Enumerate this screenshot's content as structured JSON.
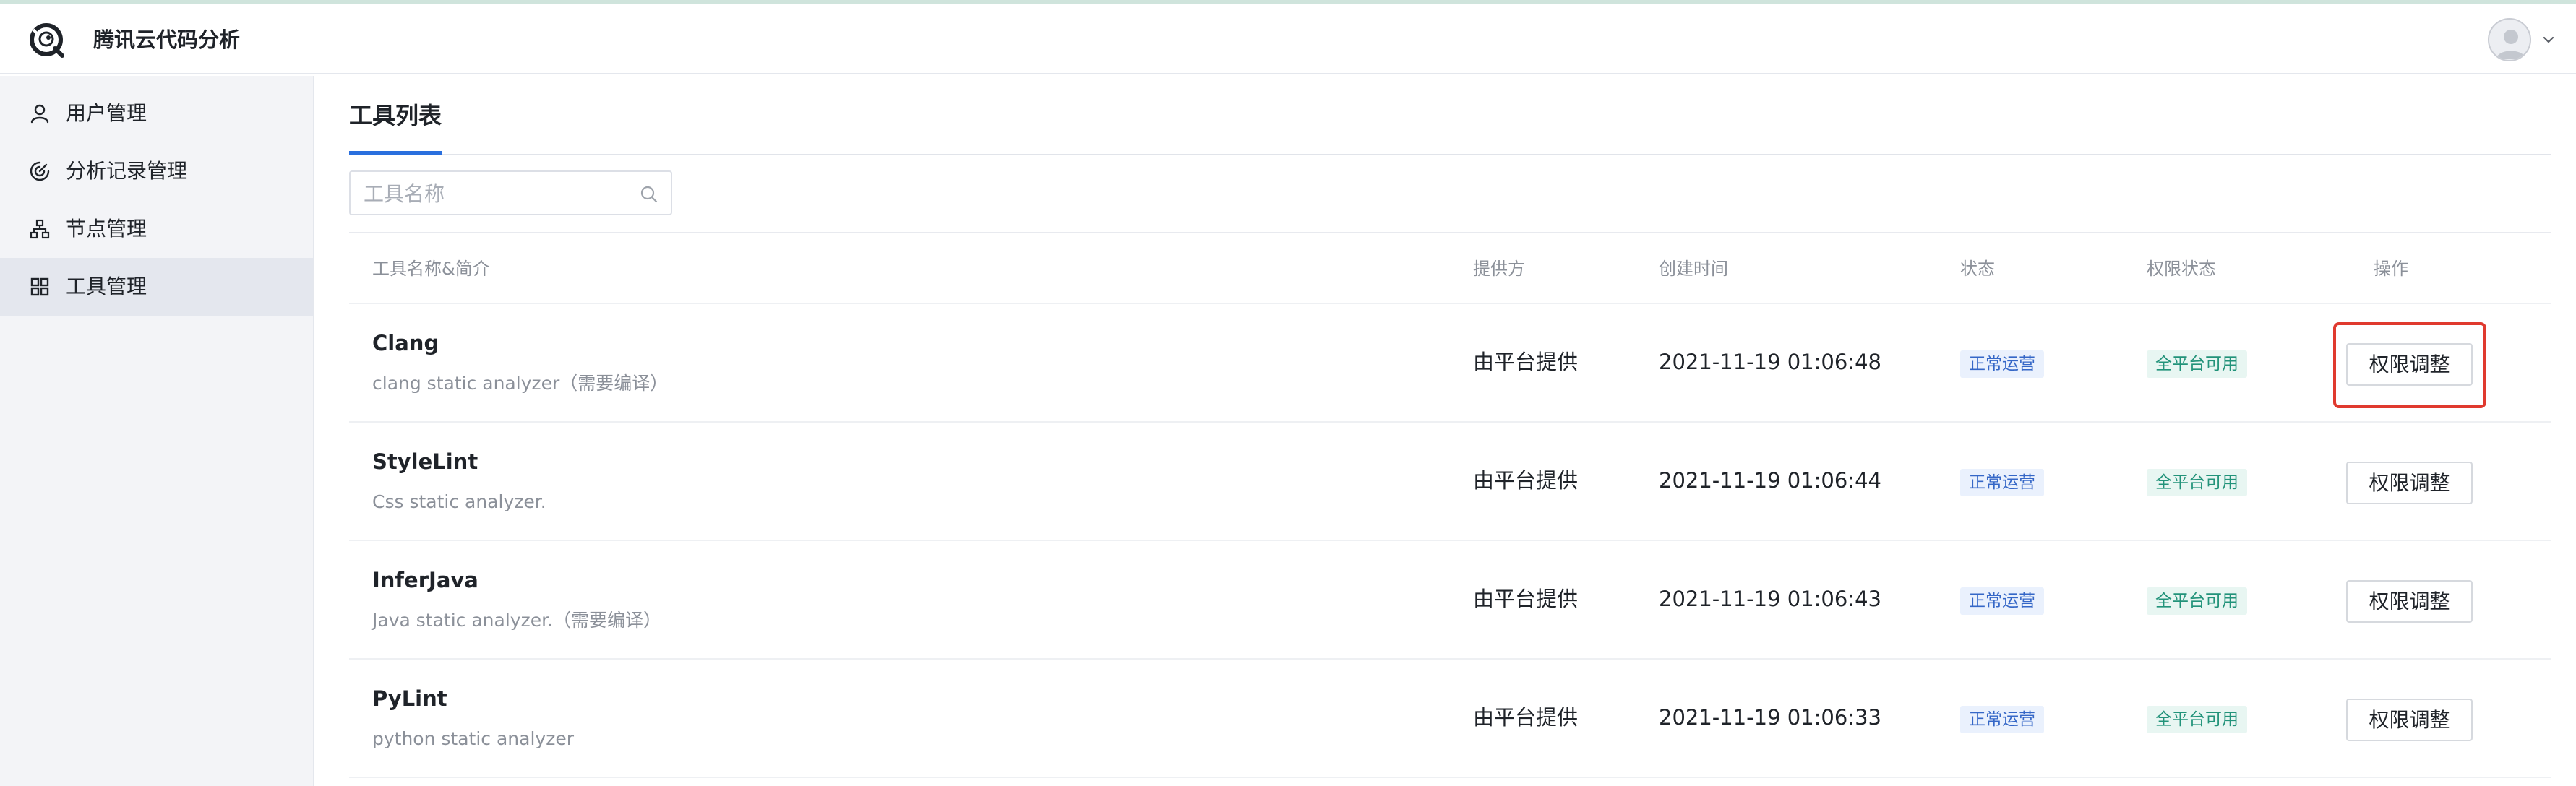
{
  "header": {
    "title": "腾讯云代码分析"
  },
  "sidebar": {
    "items": [
      {
        "label": "用户管理",
        "icon": "user-icon"
      },
      {
        "label": "分析记录管理",
        "icon": "analysis-record-icon"
      },
      {
        "label": "节点管理",
        "icon": "node-icon"
      },
      {
        "label": "工具管理",
        "icon": "grid-icon",
        "active": true
      }
    ]
  },
  "main": {
    "tab": "工具列表",
    "search": {
      "placeholder": "工具名称",
      "value": ""
    },
    "columns": {
      "name": "工具名称&简介",
      "provider": "提供方",
      "created": "创建时间",
      "status": "状态",
      "permission": "权限状态",
      "action": "操作"
    },
    "rows": [
      {
        "name": "Clang",
        "desc": "clang static analyzer（需要编译）",
        "provider": "由平台提供",
        "created": "2021-11-19 01:06:48",
        "status": "正常运营",
        "permission": "全平台可用",
        "action": "权限调整"
      },
      {
        "name": "StyleLint",
        "desc": "Css static analyzer.",
        "provider": "由平台提供",
        "created": "2021-11-19 01:06:44",
        "status": "正常运营",
        "permission": "全平台可用",
        "action": "权限调整"
      },
      {
        "name": "InferJava",
        "desc": "Java static analyzer.（需要编译）",
        "provider": "由平台提供",
        "created": "2021-11-19 01:06:43",
        "status": "正常运营",
        "permission": "全平台可用",
        "action": "权限调整"
      },
      {
        "name": "PyLint",
        "desc": "python static analyzer",
        "provider": "由平台提供",
        "created": "2021-11-19 01:06:33",
        "status": "正常运营",
        "permission": "全平台可用",
        "action": "权限调整"
      }
    ]
  },
  "colors": {
    "accent": "#2a6fde",
    "highlight": "#e03a2f",
    "status_badge_bg": "#eaf1fd",
    "status_badge_text": "#3567c7",
    "permission_badge_bg": "#e8f6f2",
    "permission_badge_text": "#22937a"
  }
}
